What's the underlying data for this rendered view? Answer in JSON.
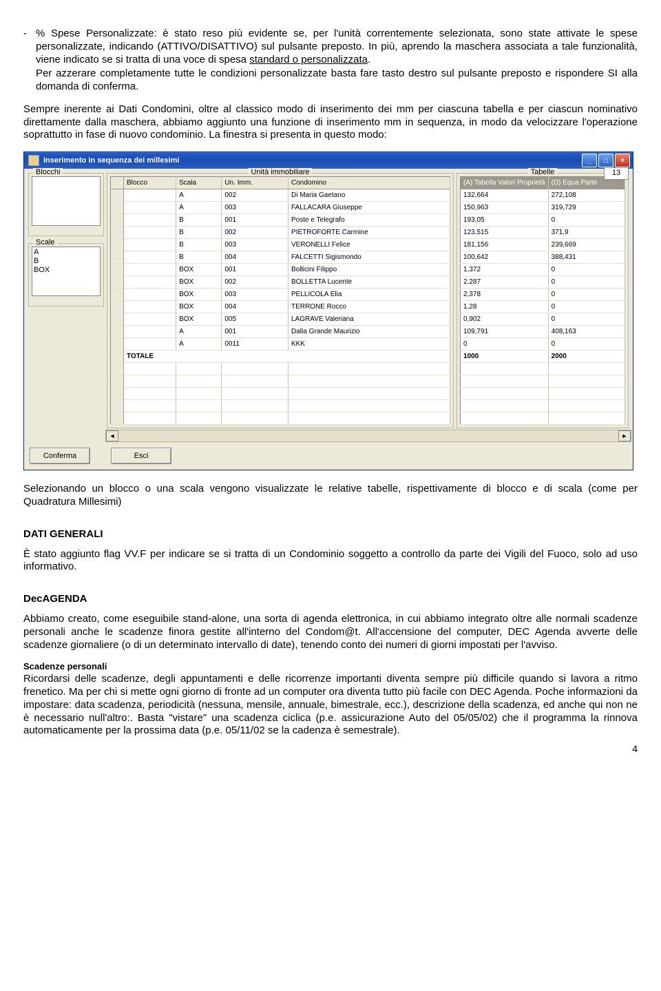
{
  "bullet1_a": "% Spese Personalizzate: è stato reso più evidente se, per l'unità correntemente selezionata, sono state attivate le spese personalizzate, indicando (ATTIVO/DISATTIVO) sul pulsante preposto. In più, aprendo la maschera associata a tale funzionalità, viene indicato se si tratta di una voce di spesa ",
  "bullet1_u": "standard o personalizzata",
  "bullet1_b": ".",
  "para1": "Per azzerare completamente tutte le condizioni personalizzate basta fare tasto destro sul pulsante preposto e rispondere SI alla domanda di conferma.",
  "para2": "Sempre inerente ai Dati Condomini, oltre al classico modo di inserimento dei mm per ciascuna tabella e per ciascun nominativo direttamente dalla maschera, abbiamo aggiunto una funzione di inserimento mm in sequenza, in modo da velocizzare l'operazione soprattutto in fase di nuovo condominio. La finestra si presenta in questo modo:",
  "win": {
    "title": "Inserimento in sequenza dei millesimi",
    "legend_blocchi": "Blocchi",
    "legend_scale": "Scale",
    "legend_unita": "Unità immobiliare",
    "legend_tabelle": "Tabelle",
    "pagecount": "13",
    "scale_items": [
      "A",
      "B",
      "BOX"
    ],
    "headers": {
      "blocco": "Blocco",
      "scala": "Scala",
      "un": "Un. Imm.",
      "cond": "Condomino",
      "tabA": "(A) Tabella Valori Proprietà",
      "tabD": "(D) Equa Parte"
    },
    "rows": [
      {
        "b": "",
        "s": "A",
        "u": "002",
        "c": "Di Maria Gaetano",
        "a": "132,664",
        "d": "272,108"
      },
      {
        "b": "",
        "s": "A",
        "u": "003",
        "c": "FALLACARA Giuseppe",
        "a": "150,963",
        "d": "319,729"
      },
      {
        "b": "",
        "s": "B",
        "u": "001",
        "c": "Poste e Telegrafo",
        "a": "193,05",
        "d": "0"
      },
      {
        "b": "",
        "s": "B",
        "u": "002",
        "c": "PIETROFORTE Carmine",
        "a": "123,515",
        "d": "371,9"
      },
      {
        "b": "",
        "s": "B",
        "u": "003",
        "c": "VERONELLI Felice",
        "a": "181,156",
        "d": "239,669"
      },
      {
        "b": "",
        "s": "B",
        "u": "004",
        "c": "FALCETTI Sigismondo",
        "a": "100,642",
        "d": "388,431"
      },
      {
        "b": "",
        "s": "BOX",
        "u": "001",
        "c": "Bollicini Filippo",
        "a": "1,372",
        "d": "0"
      },
      {
        "b": "",
        "s": "BOX",
        "u": "002",
        "c": "BOLLETTA Lucente",
        "a": "2,287",
        "d": "0"
      },
      {
        "b": "",
        "s": "BOX",
        "u": "003",
        "c": "PELLICOLA Elia",
        "a": "2,378",
        "d": "0"
      },
      {
        "b": "",
        "s": "BOX",
        "u": "004",
        "c": "TERRONE Rocco",
        "a": "1,28",
        "d": "0"
      },
      {
        "b": "",
        "s": "BOX",
        "u": "005",
        "c": "LAGRAVE Valeriana",
        "a": "0,902",
        "d": "0"
      },
      {
        "b": "",
        "s": "A",
        "u": "001",
        "c": "Dalla Grande Maurizio",
        "a": "109,791",
        "d": "408,163"
      },
      {
        "b": "",
        "s": "A",
        "u": "0011",
        "c": "KKK",
        "a": "0",
        "d": "0"
      }
    ],
    "total": {
      "label": "TOTALE",
      "a": "1000",
      "d": "2000"
    },
    "btn_conferma": "Conferma",
    "btn_esci": "Esci"
  },
  "para3": "Selezionando un blocco o una scala vengono visualizzate le relative tabelle, rispettivamente di blocco e di scala (come per Quadratura Millesimi)",
  "h_dati": "DATI GENERALI",
  "para4": "È stato aggiunto flag VV.F per indicare se si tratta di un Condominio soggetto a controllo da parte dei Vigili del Fuoco, solo ad uso informativo.",
  "h_dec": "DecAGENDA",
  "para5": "Abbiamo creato, come eseguibile stand-alone, una sorta di agenda elettronica, in cui abbiamo integrato oltre alle normali scadenze personali anche le scadenze finora gestite all'interno del Condom@t.  All'accensione del computer, DEC Agenda avverte delle scadenze giornaliere (o di un determinato intervallo di date), tenendo conto dei numeri di giorni impostati per l'avviso.",
  "sub_scad": "Scadenze personali",
  "para6": "Ricordarsi delle scadenze, degli appuntamenti e delle ricorrenze importanti diventa sempre più difficile quando si lavora a ritmo frenetico. Ma per chi si mette ogni giorno di fronte ad un computer ora diventa tutto più facile con DEC Agenda. Poche informazioni da impostare: data scadenza, periodicità (nessuna, mensile, annuale, bimestrale, ecc.), descrizione della scadenza, ed anche qui non ne è necessario null'altro:. Basta \"vistare\" una scadenza ciclica (p.e. assicurazione Auto del 05/05/02) che il programma la rinnova automaticamente per la prossima data (p.e. 05/11/02 se la cadenza è semestrale).",
  "pagenum": "4"
}
